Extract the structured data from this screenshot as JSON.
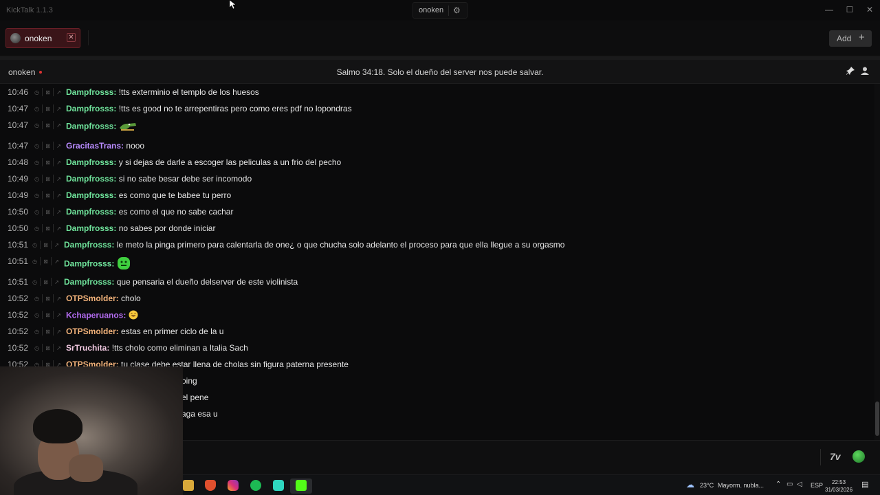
{
  "app": {
    "title": "KickTalk 1.1.3"
  },
  "top_tab": {
    "label": "onoken",
    "settings_icon": "gear-icon"
  },
  "window_controls": {
    "minimize": "—",
    "maximize": "☐",
    "close": "✕"
  },
  "tabs": [
    {
      "label": "onoken",
      "close": "✕",
      "active": true
    }
  ],
  "add_button": {
    "label": "Add",
    "icon": "+"
  },
  "header": {
    "channel": "onoken",
    "title": "Salmo 34:18. Solo el dueño del server nos puede salvar."
  },
  "colors": {
    "green_user": "#6fe39b",
    "purple_user": "#b98cff",
    "orange_user": "#f2b27a",
    "pink_user": "#f0c8e0",
    "violet_user": "#b36cf0",
    "live": "#dd3333"
  },
  "messages": [
    {
      "time": "10:46",
      "user": "Dampfrosss:",
      "color": "green",
      "text": "!tts exterminio el templo de los huesos"
    },
    {
      "time": "10:47",
      "user": "Dampfrosss:",
      "color": "green",
      "text": "!tts es good no te arrepentiras pero como eres pdf no lopondras"
    },
    {
      "time": "10:47",
      "user": "Dampfrosss:",
      "color": "green",
      "text": "",
      "emote": "crocodile-emote"
    },
    {
      "time": "10:47",
      "user": "GracitasTrans:",
      "color": "purple",
      "text": "nooo"
    },
    {
      "time": "10:48",
      "user": "Dampfrosss:",
      "color": "green",
      "text": "y si dejas de darle a escoger las peliculas a un frio del pecho"
    },
    {
      "time": "10:49",
      "user": "Dampfrosss:",
      "color": "green",
      "text": "si no sabe besar debe ser incomodo"
    },
    {
      "time": "10:49",
      "user": "Dampfrosss:",
      "color": "green",
      "text": "es como que te babee tu perro"
    },
    {
      "time": "10:50",
      "user": "Dampfrosss:",
      "color": "green",
      "text": "es como el que no sabe cachar"
    },
    {
      "time": "10:50",
      "user": "Dampfrosss:",
      "color": "green",
      "text": "no sabes por donde iniciar"
    },
    {
      "time": "10:51",
      "user": "Dampfrosss:",
      "color": "green",
      "text": "le meto la pinga primero para calentarla de one¿ o que chucha solo adelanto el proceso para que ella llegue a su orgasmo"
    },
    {
      "time": "10:51",
      "user": "Dampfrosss:",
      "color": "green",
      "text": "",
      "emote": "green-blob-emote"
    },
    {
      "time": "10:51",
      "user": "Dampfrosss:",
      "color": "green",
      "text": "que pensaria el dueño delserver de este violinista"
    },
    {
      "time": "10:52",
      "user": "OTPSmolder:",
      "color": "orange",
      "text": "cholo"
    },
    {
      "time": "10:52",
      "user": "Kchaperuanos:",
      "color": "violet",
      "text": "",
      "emote": "laughing-emoji"
    },
    {
      "time": "10:52",
      "user": "OTPSmolder:",
      "color": "orange",
      "text": "estas en primer ciclo de la u"
    },
    {
      "time": "10:52",
      "user": "SrTruchita:",
      "color": "pink",
      "text": "!tts cholo como eliminan a Italia Sach"
    },
    {
      "time": "10:52",
      "user": "OTPSmolder:",
      "color": "orange",
      "text": "tu clase debe estar llena de cholas sin figura paterna presente"
    },
    {
      "time": "",
      "user": "",
      "color": "green",
      "text": "oing"
    },
    {
      "time": "",
      "user": "",
      "color": "green",
      "text": "el pene"
    },
    {
      "time": "",
      "user": "",
      "color": "green",
      "text": "aga esa u"
    }
  ],
  "input": {
    "placeholder": ""
  },
  "taskbar": {
    "weather": "23°C",
    "weather_desc": "Mayorm. nubla...",
    "lang": "ESP",
    "time": "22:53",
    "date": "31/03/2026"
  }
}
